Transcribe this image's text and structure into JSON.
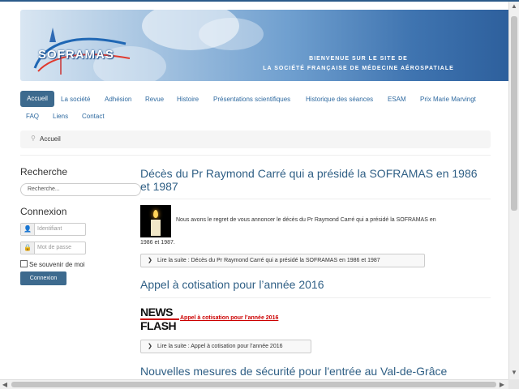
{
  "banner": {
    "logo_text": "SOFRAMAS",
    "welcome_line1": "Bienvenue sur le site de",
    "welcome_line2": "La Société Française de Médecine Aérospatiale"
  },
  "nav": {
    "items": [
      {
        "label": "Accueil",
        "active": true
      },
      {
        "label": "La société"
      },
      {
        "label": "Adhésion"
      },
      {
        "label": "Revue"
      },
      {
        "label": "Histoire"
      },
      {
        "label": "Présentations scientifiques"
      },
      {
        "label": "Historique des séances"
      },
      {
        "label": "ESAM"
      },
      {
        "label": "Prix Marie Marvingt"
      },
      {
        "label": "FAQ"
      },
      {
        "label": "Liens"
      },
      {
        "label": "Contact"
      }
    ]
  },
  "breadcrumb": {
    "current": "Accueil",
    "icon": "map-pin-icon"
  },
  "sidebar": {
    "search_heading": "Recherche",
    "search_placeholder": "Recherche...",
    "login_heading": "Connexion",
    "username_placeholder": "Identifiant",
    "password_placeholder": "Mot de passe",
    "remember_label": "Se souvenir de moi",
    "login_button": "Connexion"
  },
  "articles": [
    {
      "title": "Décès du Pr Raymond Carré qui a présidé la SOFRAMAS en 1986 et 1987",
      "intro_part1": "Nous avons le regret de vous annoncer le décès du Pr Raymond Carré qui a présidé la SOFRAMAS en",
      "intro_part2": "1986 et 1987.",
      "read_more": "Lire la suite : Décès du Pr Raymond Carré qui a présidé la SOFRAMAS en 1986 et 1987"
    },
    {
      "title": "Appel à cotisation pour l’année 2016",
      "badge_line1": "NEWS",
      "badge_line2": "FLASH",
      "link_text": "Appel à cotisation pour l’année 2016",
      "read_more": "Lire la suite : Appel à cotisation pour l’année 2016"
    },
    {
      "title": "Nouvelles mesures de sécurité pour l'entrée au Val-de-Grâce"
    }
  ],
  "colors": {
    "accent": "#3d6a8e",
    "title": "#2f5f85",
    "link": "#2f6aa0",
    "flash_red": "#cc0000"
  }
}
